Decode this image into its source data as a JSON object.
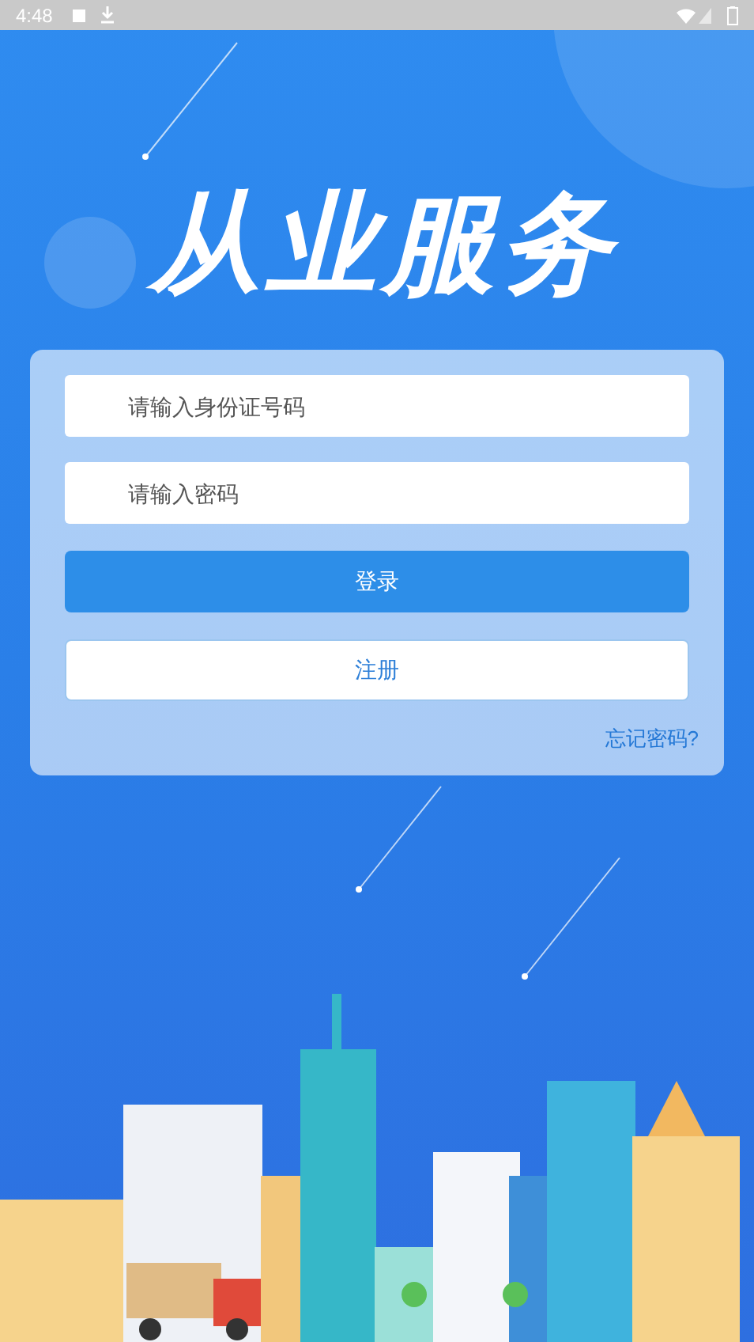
{
  "status_bar": {
    "time": "4:48"
  },
  "title": "从业服务",
  "login_form": {
    "id_field": {
      "placeholder": "请输入身份证号码"
    },
    "password_field": {
      "placeholder": "请输入密码"
    },
    "login_button": "登录",
    "register_button": "注册",
    "forgot_link": "忘记密码?"
  }
}
